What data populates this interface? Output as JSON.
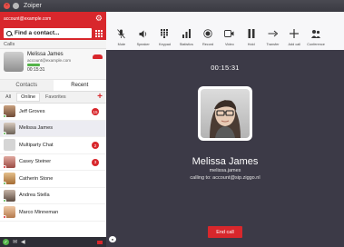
{
  "window": {
    "title": "Zoiper"
  },
  "sidebar": {
    "account": "account@example.com",
    "search_placeholder": "Find a contact...",
    "calls_header": "Calls",
    "active_call": {
      "name": "Melissa James",
      "account": "account@example.com",
      "timer": "00:15:31"
    },
    "tabs": [
      "Contacts",
      "Recent"
    ],
    "active_tab": "Recent",
    "filters": [
      "All",
      "Online",
      "Favorites"
    ],
    "active_filter": "Online",
    "contacts": [
      {
        "name": "Jeff Groves",
        "badge": "15",
        "status": "online"
      },
      {
        "name": "Melissa James",
        "badge": "",
        "status": "online",
        "selected": true
      },
      {
        "name": "Multiparty Chat",
        "badge": "2",
        "status": ""
      },
      {
        "name": "Casey Steiner",
        "badge": "3",
        "status": "busy"
      },
      {
        "name": "Catherin Stone",
        "badge": "",
        "status": "online"
      },
      {
        "name": "Andrea Stella",
        "badge": "",
        "status": "online"
      },
      {
        "name": "Marco Minneman",
        "badge": "",
        "status": "busy"
      }
    ]
  },
  "toolbar": {
    "items": [
      {
        "label": "Mute",
        "icon": "mic-off-icon"
      },
      {
        "label": "Speaker",
        "icon": "speaker-icon"
      },
      {
        "label": "Keypad",
        "icon": "keypad-icon"
      },
      {
        "label": "Statistics",
        "icon": "statistics-icon"
      },
      {
        "label": "Record",
        "icon": "record-icon"
      },
      {
        "label": "Video",
        "icon": "video-icon"
      },
      {
        "label": "Hold",
        "icon": "pause-icon"
      },
      {
        "label": "Transfer",
        "icon": "transfer-icon"
      },
      {
        "label": "Add call",
        "icon": "plus-icon"
      },
      {
        "label": "Conference",
        "icon": "conference-icon"
      }
    ]
  },
  "call": {
    "duration": "00:15:31",
    "name": "Melissa James",
    "username": "melissa.james",
    "calling_to": "calling to: account@sip.ziggo.nl",
    "end_label": "End call"
  },
  "colors": {
    "accent": "#d8272c",
    "online": "#55b44a",
    "main_bg": "#3c3a47"
  }
}
